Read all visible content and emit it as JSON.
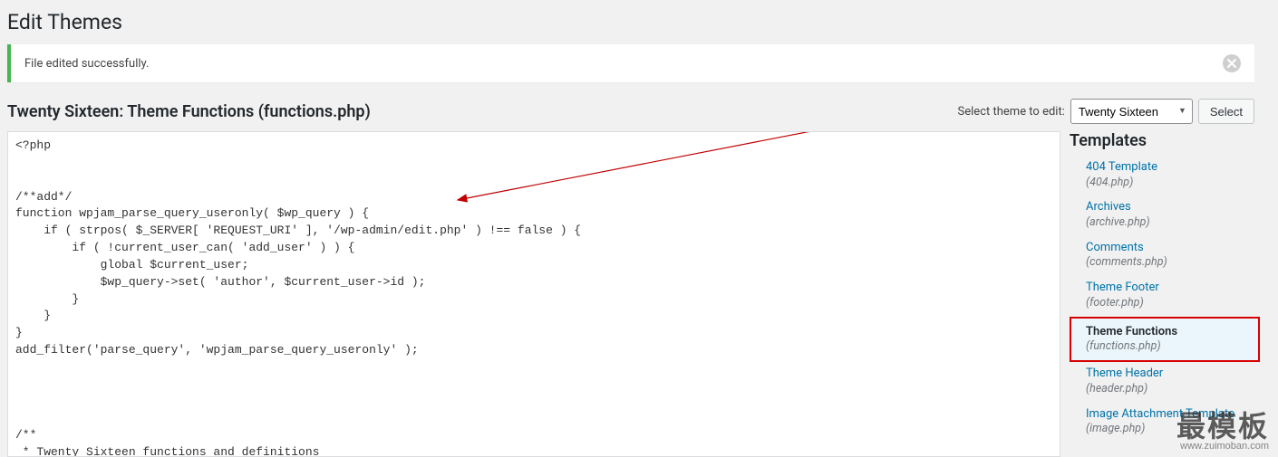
{
  "page_title": "Edit Themes",
  "notice": {
    "message": "File edited successfully."
  },
  "file_heading": "Twenty Sixteen: Theme Functions (functions.php)",
  "theme_selector": {
    "label": "Select theme to edit:",
    "selected": "Twenty Sixteen",
    "button": "Select"
  },
  "editor": {
    "content": "<?php\n\n\n/**add*/\nfunction wpjam_parse_query_useronly( $wp_query ) {\n    if ( strpos( $_SERVER[ 'REQUEST_URI' ], '/wp-admin/edit.php' ) !== false ) {\n        if ( !current_user_can( 'add_user' ) ) {\n            global $current_user;\n            $wp_query->set( 'author', $current_user->id );\n        }\n    }\n}\nadd_filter('parse_query', 'wpjam_parse_query_useronly' );\n\n\n\n\n/**\n * Twenty Sixteen functions and definitions"
  },
  "sidebar_heading": "Templates",
  "templates": [
    {
      "label": "404 Template",
      "filename": "(404.php)",
      "selected": false
    },
    {
      "label": "Archives",
      "filename": "(archive.php)",
      "selected": false
    },
    {
      "label": "Comments",
      "filename": "(comments.php)",
      "selected": false
    },
    {
      "label": "Theme Footer",
      "filename": "(footer.php)",
      "selected": false
    },
    {
      "label": "Theme Functions",
      "filename": "(functions.php)",
      "selected": true
    },
    {
      "label": "Theme Header",
      "filename": "(header.php)",
      "selected": false
    },
    {
      "label": "Image Attachment Template",
      "filename": "(image.php)",
      "selected": false
    }
  ],
  "watermark": {
    "big": "最模板",
    "small": "www.zuimoban.com"
  }
}
